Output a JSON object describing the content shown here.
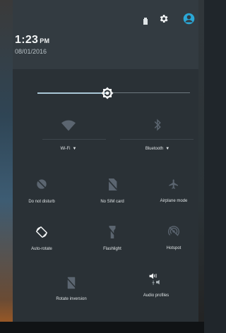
{
  "header": {
    "time": "1:23",
    "ampm": "PM",
    "date": "08/01/2016",
    "icons": [
      "battery-icon",
      "settings-icon",
      "user-icon"
    ],
    "accent": "#2aa7d6"
  },
  "brightness": {
    "level": 0.46
  },
  "toggles": [
    {
      "name": "wifi",
      "label": "Wi-Fi"
    },
    {
      "name": "bluetooth",
      "label": "Bluetooth"
    }
  ],
  "tiles": [
    {
      "name": "do-not-disturb",
      "label": "Do not disturb"
    },
    {
      "name": "sim",
      "label": "No SIM card"
    },
    {
      "name": "airplane",
      "label": "Airplane mode"
    },
    {
      "name": "auto-rotate",
      "label": "Auto-rotate"
    },
    {
      "name": "flashlight",
      "label": "Flashlight"
    },
    {
      "name": "hotspot",
      "label": "Hotspot"
    },
    {
      "name": "rotate-inversion",
      "label": "Rotate inversion"
    },
    {
      "name": "audio-profiles",
      "label": "Audio profiles"
    }
  ]
}
